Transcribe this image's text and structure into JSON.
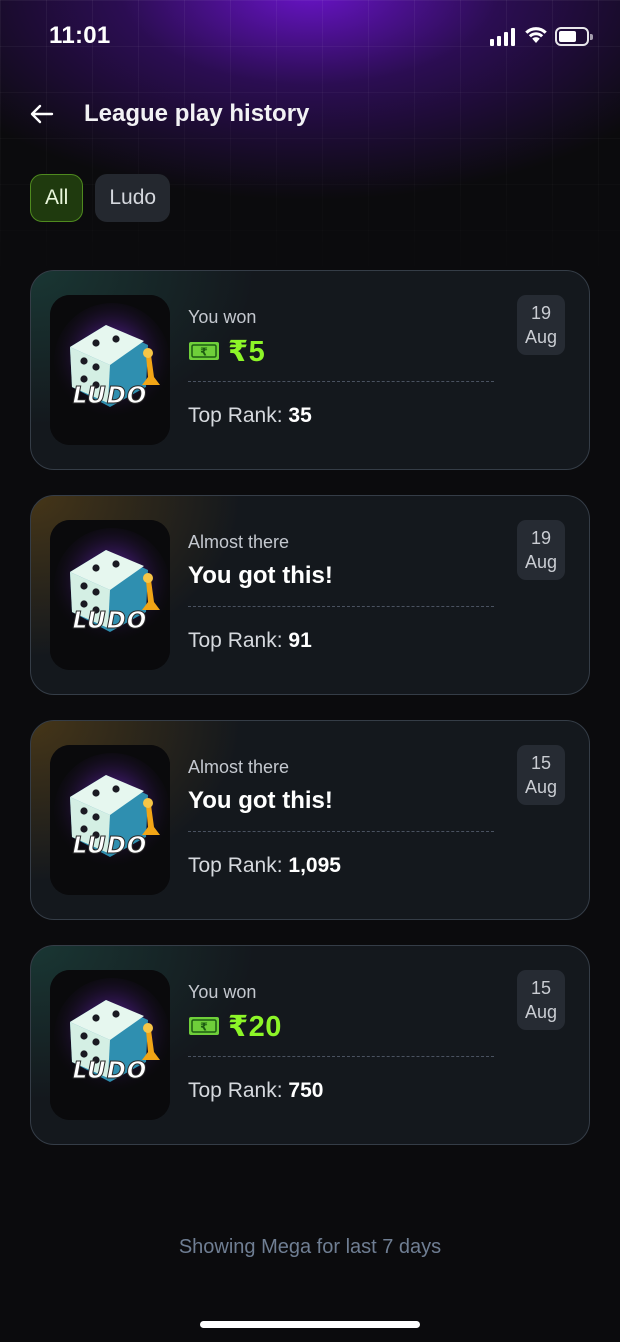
{
  "status_bar": {
    "time": "11:01"
  },
  "header": {
    "title": "League play history"
  },
  "filters": [
    {
      "label": "All",
      "active": true
    },
    {
      "label": "Ludo",
      "active": false
    }
  ],
  "games": [
    {
      "status": "won",
      "game_logo": "LUDO",
      "headline": "You won",
      "prize": "₹5",
      "rank_label": "Top Rank:",
      "rank": "35",
      "date_day": "19",
      "date_month": "Aug"
    },
    {
      "status": "almost",
      "game_logo": "LUDO",
      "headline": "Almost there",
      "message": "You got this!",
      "rank_label": "Top Rank:",
      "rank": "91",
      "date_day": "19",
      "date_month": "Aug"
    },
    {
      "status": "almost",
      "game_logo": "LUDO",
      "headline": "Almost there",
      "message": "You got this!",
      "rank_label": "Top Rank:",
      "rank": "1,095",
      "date_day": "15",
      "date_month": "Aug"
    },
    {
      "status": "won",
      "game_logo": "LUDO",
      "headline": "You won",
      "prize": "₹20",
      "rank_label": "Top Rank:",
      "rank": "750",
      "date_day": "15",
      "date_month": "Aug"
    }
  ],
  "footer": {
    "note": "Showing Mega for last 7 days"
  },
  "colors": {
    "accent_green": "#8df528",
    "chip_active_bg": "#1f3a0e",
    "background": "#0b0b0d"
  },
  "icons": {
    "back": "arrow-left-icon",
    "prize": "cash-note-icon",
    "game": "ludo-dice-icon"
  }
}
